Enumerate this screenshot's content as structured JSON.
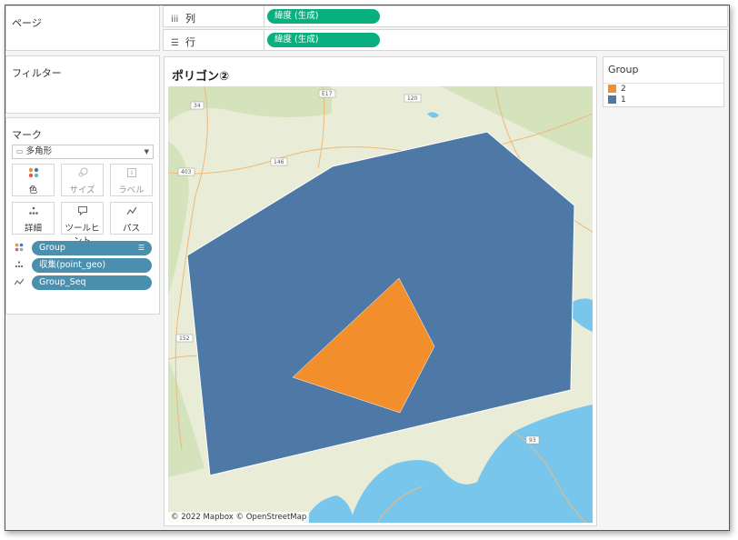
{
  "shelves": {
    "pages_label": "ページ",
    "filters_label": "フィルター",
    "columns": {
      "icon": "iii",
      "label": "列",
      "pill": "緯度 (生成)"
    },
    "rows": {
      "icon": "☰",
      "label": "行",
      "pill": "緯度 (生成)"
    }
  },
  "marks": {
    "title": "マーク",
    "mark_type": "多角形",
    "buttons": {
      "color": "色",
      "size": "サイズ",
      "label": "ラベル",
      "detail": "詳細",
      "tooltip": "ツールヒント",
      "path": "パス"
    },
    "fields": [
      {
        "name": "Group"
      },
      {
        "name": "収集(point_geo)"
      },
      {
        "name": "Group_Seq"
      }
    ]
  },
  "viz": {
    "title": "ポリゴン②",
    "attribution": "© 2022 Mapbox © OpenStreetMap",
    "road_labels": [
      "34",
      "E17",
      "120",
      "403",
      "146",
      "152",
      "93"
    ]
  },
  "legend": {
    "title": "Group",
    "items": [
      {
        "label": "2",
        "color": "#f28e2b"
      },
      {
        "label": "1",
        "color": "#4e79a7"
      }
    ]
  },
  "colors": {
    "polygon_1": "#4e79a7",
    "polygon_2": "#f28e2b",
    "pill_green": "#09b07f",
    "pill_blue": "#4a8fae"
  }
}
